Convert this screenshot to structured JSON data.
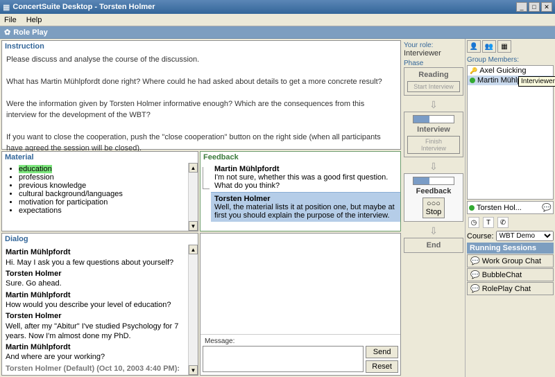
{
  "window": {
    "title": "ConcertSuite Desktop - Torsten Holmer"
  },
  "menu": {
    "file": "File",
    "help": "Help"
  },
  "subtitle": "Role Play",
  "instruction": {
    "label": "Instruction",
    "p1": "Please discuss and analyse the course of the discussion.",
    "p2": "What has Martin Mühlpfordt done right? Where could he had asked about details to get a more concrete result?",
    "p3": "Were the information given by Torsten Holmer informative enough? Which are the consequences from this interview for the development of the WBT?",
    "p4": "If you want to close the cooperation, push the \"close cooperation\" button on the right side (when all participants have agreed the session will be closed)."
  },
  "material": {
    "label": "Material",
    "items": [
      "education",
      "profession",
      "previous knowledge",
      "cultural background/languages",
      "motivation for participation",
      "expectations"
    ]
  },
  "feedback": {
    "label": "Feedback",
    "a_name": "Martin Mühlpfordt",
    "a_text": "I'm not sure, whether this was a good first question. What do you think?",
    "b_name": "Torsten Holmer",
    "b_text": "Well, the material lists it at position one, but maybe at first you should explain the purpose of the interview."
  },
  "dialog": {
    "label": "Dialog",
    "n1": "Martin Mühlpfordt",
    "t1": "Hi. May I ask you a few questions about yourself?",
    "n2": "Torsten Holmer",
    "t2": "Sure. Go ahead.",
    "n3": "Martin Mühlpfordt",
    "t3": "How would you describe your level of education?",
    "n4": "Torsten Holmer",
    "t4": "Well, after my \"Abitur\" I've studied Psychology for 7 years. Now I'm almost done my PhD.",
    "n5": "Martin Mühlpfordt",
    "t5": "And where are your working?",
    "n6": "Torsten Holmer (Default) (Oct 10, 2003 4:40 PM):"
  },
  "message": {
    "label": "Message:",
    "send": "Send",
    "reset": "Reset"
  },
  "phase": {
    "your_role_label": "Your role:",
    "your_role": "Interviewer",
    "label": "Phase",
    "reading": "Reading",
    "start": "Start Interview",
    "interview": "Interview",
    "finish": "Finish Interview",
    "feedback": "Feedback",
    "stop": "Stop",
    "end": "End"
  },
  "right": {
    "group_label": "Group Members:",
    "m1": "Axel Guicking",
    "m2": "Martin Mühlp...",
    "tooltip": "Interviewer",
    "status_name": "Torsten Hol...",
    "course_label": "Course:",
    "course_value": "WBT Demo",
    "sessions_label": "Running Sessions",
    "s1": "Work Group Chat",
    "s2": "BubbleChat",
    "s3": "RolePlay Chat"
  }
}
